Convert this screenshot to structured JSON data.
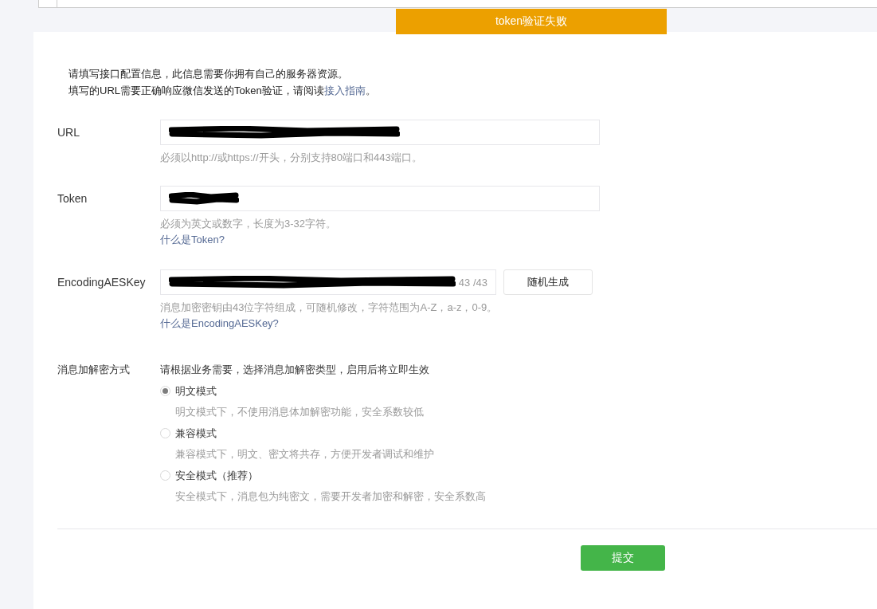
{
  "notice": "token验证失败",
  "intro": {
    "line_1": "请填写接口配置信息，此信息需要你拥有自己的服务器资源。",
    "line_2": "填写的URL需要正确响应微信发送的Token验证，请阅读",
    "line_2_link": "接入指南",
    "line_2_end": "。"
  },
  "fields": [
    {
      "label": "URL",
      "kind": "text",
      "redacted": true,
      "hint": "必须以http://或https://开头，分别支持80端口和443端口。"
    },
    {
      "label": "Token",
      "kind": "text",
      "redacted": true,
      "hint": "必须为英文或数字，长度为3-32字符。",
      "help_link": "什么是Token?"
    },
    {
      "label": "EncodingAESKey",
      "kind": "key",
      "redacted": true,
      "counter": "43 /43",
      "button": "随机生成",
      "hint": "消息加密密钥由43位字符组成，可随机修改，字符范围为A-Z，a-z，0-9。",
      "help_link": "什么是EncodingAESKey?"
    }
  ],
  "encryption": {
    "label": "消息加解密方式",
    "description": "请根据业务需要，选择消息加解密类型，启用后将立即生效",
    "options": [
      {
        "label": "明文模式",
        "selected": true,
        "description": "明文模式下，不使用消息体加解密功能，安全系数较低"
      },
      {
        "label": "兼容模式",
        "selected": false,
        "description": "兼容模式下，明文、密文将共存，方便开发者调试和维护"
      },
      {
        "label": "安全模式（推荐）",
        "selected": false,
        "description": "安全模式下，消息包为纯密文，需要开发者加密和解密，安全系数高"
      }
    ]
  },
  "submit": "提交"
}
